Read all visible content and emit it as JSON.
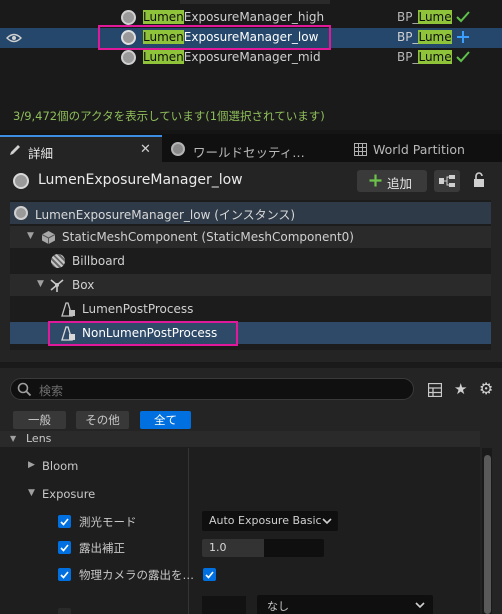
{
  "outliner": {
    "rows": [
      {
        "match": "Lumen",
        "rest": "ExposureManager_high",
        "type_prefix": "BP_",
        "type_match": "Lume",
        "status": "check"
      },
      {
        "match": "Lumen",
        "rest": "ExposureManager_low",
        "type_prefix": "BP_",
        "type_match": "Lume",
        "status": "plus"
      },
      {
        "match": "Lumen",
        "rest": "ExposureManager_mid",
        "type_prefix": "BP_",
        "type_match": "Lume",
        "status": "check"
      }
    ],
    "status_text": "3/9,472個のアクタを表示しています(1個選択されています)"
  },
  "tabs": {
    "details": "詳細",
    "world_settings": "ワールドセッティ…",
    "world_partition": "World Partition"
  },
  "details": {
    "actor_name": "LumenExposureManager_low",
    "add_button": "追加",
    "components": [
      {
        "label": "LumenExposureManager_low (インスタンス)"
      },
      {
        "label": "StaticMeshComponent (StaticMeshComponent0)"
      },
      {
        "label": "Billboard"
      },
      {
        "label": "Box"
      },
      {
        "label": "LumenPostProcess"
      },
      {
        "label": "NonLumenPostProcess"
      }
    ],
    "search_placeholder": "検索",
    "filters": {
      "general": "一般",
      "other": "その他",
      "all": "全て"
    },
    "sections": {
      "lens": "Lens",
      "bloom": "Bloom",
      "exposure": "Exposure"
    },
    "properties": {
      "metering_mode_label": "測光モード",
      "metering_mode_value": "Auto Exposure Basic",
      "exposure_comp_label": "露出補正",
      "exposure_comp_value": "1.0",
      "physical_camera_label": "物理カメラの露出を…",
      "none_value": "なし"
    }
  },
  "colors": {
    "accent_blue": "#0070e0",
    "match_green": "#8fc43a",
    "highlight": "#e0189a"
  }
}
